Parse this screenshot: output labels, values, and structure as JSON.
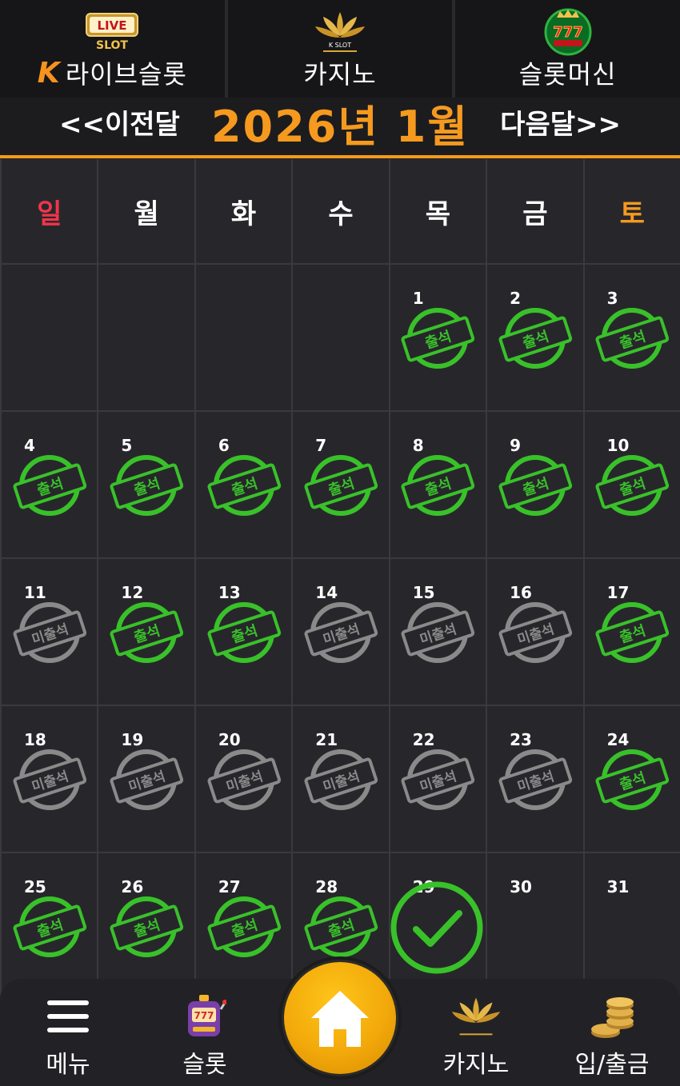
{
  "top_nav": {
    "tabs": [
      {
        "label": "라이브슬롯",
        "logo": "live-slot-logo",
        "logo_text_top": "LIVE",
        "logo_text_bottom": "SLOT"
      },
      {
        "label": "카지노",
        "logo": "k-slot-lotus-logo",
        "logo_text": "K SLOT"
      },
      {
        "label": "슬롯머신",
        "logo": "777-slots-logo",
        "logo_text": "777"
      }
    ],
    "brand_mark": "K"
  },
  "calendar": {
    "title": "2026년 1월",
    "prev_label": "<<이전달",
    "next_label": "다음달>>",
    "weekdays": [
      "일",
      "월",
      "화",
      "수",
      "목",
      "금",
      "토"
    ],
    "attended_label": "출석",
    "missed_label": "미출석",
    "colors": {
      "attended": "#39c12a",
      "missed": "#8a8a8a",
      "accent": "#f59a1f",
      "sunday": "#f0354a"
    },
    "days": [
      {
        "day": "",
        "status": ""
      },
      {
        "day": "",
        "status": ""
      },
      {
        "day": "",
        "status": ""
      },
      {
        "day": "",
        "status": ""
      },
      {
        "day": "1",
        "status": "attended"
      },
      {
        "day": "2",
        "status": "attended"
      },
      {
        "day": "3",
        "status": "attended"
      },
      {
        "day": "4",
        "status": "attended"
      },
      {
        "day": "5",
        "status": "attended"
      },
      {
        "day": "6",
        "status": "attended"
      },
      {
        "day": "7",
        "status": "attended"
      },
      {
        "day": "8",
        "status": "attended"
      },
      {
        "day": "9",
        "status": "attended"
      },
      {
        "day": "10",
        "status": "attended"
      },
      {
        "day": "11",
        "status": "missed"
      },
      {
        "day": "12",
        "status": "attended"
      },
      {
        "day": "13",
        "status": "attended"
      },
      {
        "day": "14",
        "status": "missed"
      },
      {
        "day": "15",
        "status": "missed"
      },
      {
        "day": "16",
        "status": "missed"
      },
      {
        "day": "17",
        "status": "attended"
      },
      {
        "day": "18",
        "status": "missed"
      },
      {
        "day": "19",
        "status": "missed"
      },
      {
        "day": "20",
        "status": "missed"
      },
      {
        "day": "21",
        "status": "missed"
      },
      {
        "day": "22",
        "status": "missed"
      },
      {
        "day": "23",
        "status": "missed"
      },
      {
        "day": "24",
        "status": "attended"
      },
      {
        "day": "25",
        "status": "attended"
      },
      {
        "day": "26",
        "status": "attended"
      },
      {
        "day": "27",
        "status": "attended"
      },
      {
        "day": "28",
        "status": "attended"
      },
      {
        "day": "29",
        "status": "today"
      },
      {
        "day": "30",
        "status": ""
      },
      {
        "day": "31",
        "status": ""
      }
    ]
  },
  "bottom_nav": {
    "items": [
      {
        "label": "메뉴",
        "icon": "hamburger-menu-icon"
      },
      {
        "label": "슬롯",
        "icon": "slot-machine-icon"
      },
      {
        "label": "",
        "icon": "home-icon"
      },
      {
        "label": "카지노",
        "icon": "casino-lotus-icon"
      },
      {
        "label": "입/출금",
        "icon": "coins-icon"
      }
    ]
  }
}
